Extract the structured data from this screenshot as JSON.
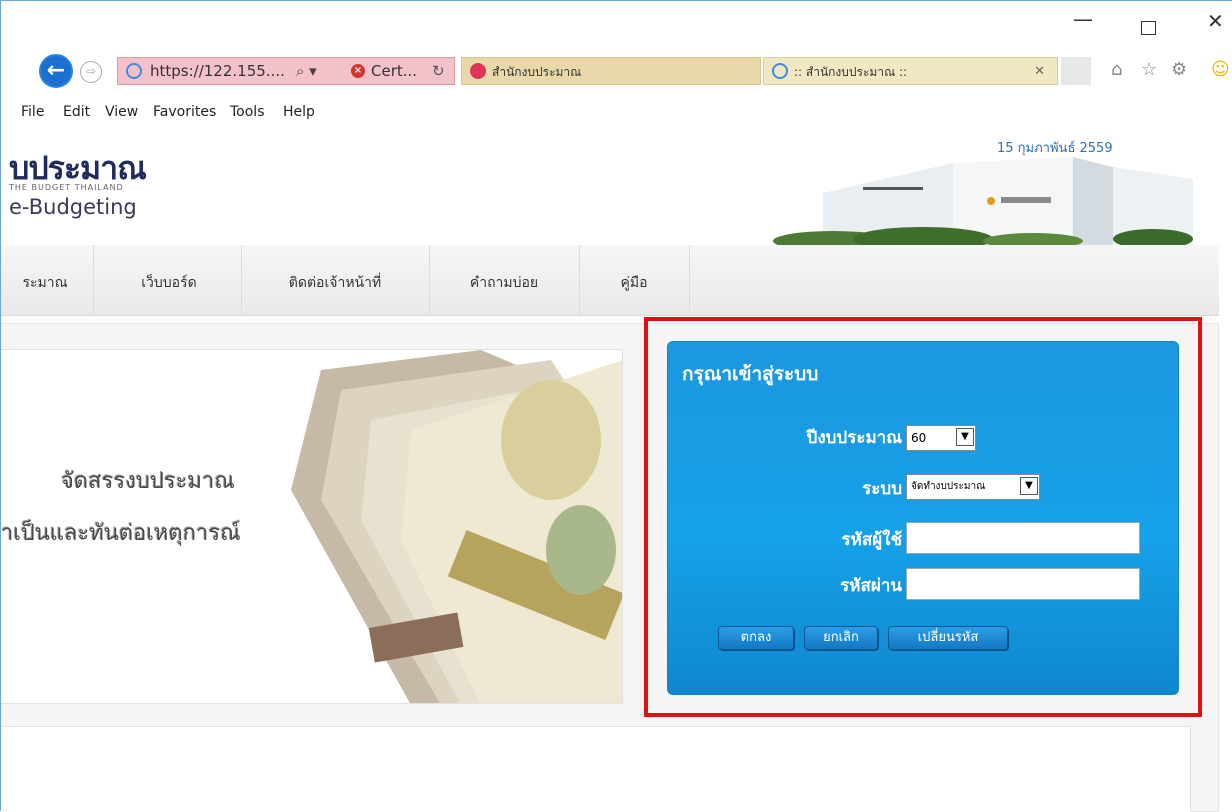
{
  "browser": {
    "url": "https://122.155....",
    "search_glyph": "⌕ ▾",
    "cert_label": "Cert...",
    "refresh_glyph": "↻",
    "tabs": [
      {
        "label": "สำนักงบประมาณ"
      },
      {
        "label": ":: สำนักงบประมาณ ::",
        "close": "✕"
      }
    ],
    "window_controls": {
      "minimize": "—",
      "close": "✕"
    },
    "menu": [
      "File",
      "Edit",
      "View",
      "Favorites",
      "Tools",
      "Help"
    ]
  },
  "header": {
    "logo_thai": "บประมาณ",
    "logo_english": "THE BUDGET THAILAND",
    "logo_ebudget": "e-Budgeting",
    "date": "15 กุมภาพันธ์ 2559"
  },
  "nav": {
    "items": [
      "ระมาณ",
      "เว็บบอร์ด",
      "ติดต่อเจ้าหน้าที่",
      "คำถามบ่อย",
      "คู่มือ"
    ]
  },
  "banner": {
    "line1": "จัดสรรงบประมาณ",
    "line2": "ำเป็นและทันต่อเหตุการณ์"
  },
  "login": {
    "title": "กรุณาเข้าสู่ระบบ",
    "year_label": "ปีงบประมาณ",
    "year_value": "60",
    "system_label": "ระบบ",
    "system_value": "จัดทำงบประมาณ",
    "username_label": "รหัสผู้ใช้",
    "username_value": "",
    "password_label": "รหัสผ่าน",
    "password_value": "",
    "ok_button": "ตกลง",
    "cancel_button": "ยกเลิก",
    "change_password_button": "เปลี่ยนรหัส"
  }
}
